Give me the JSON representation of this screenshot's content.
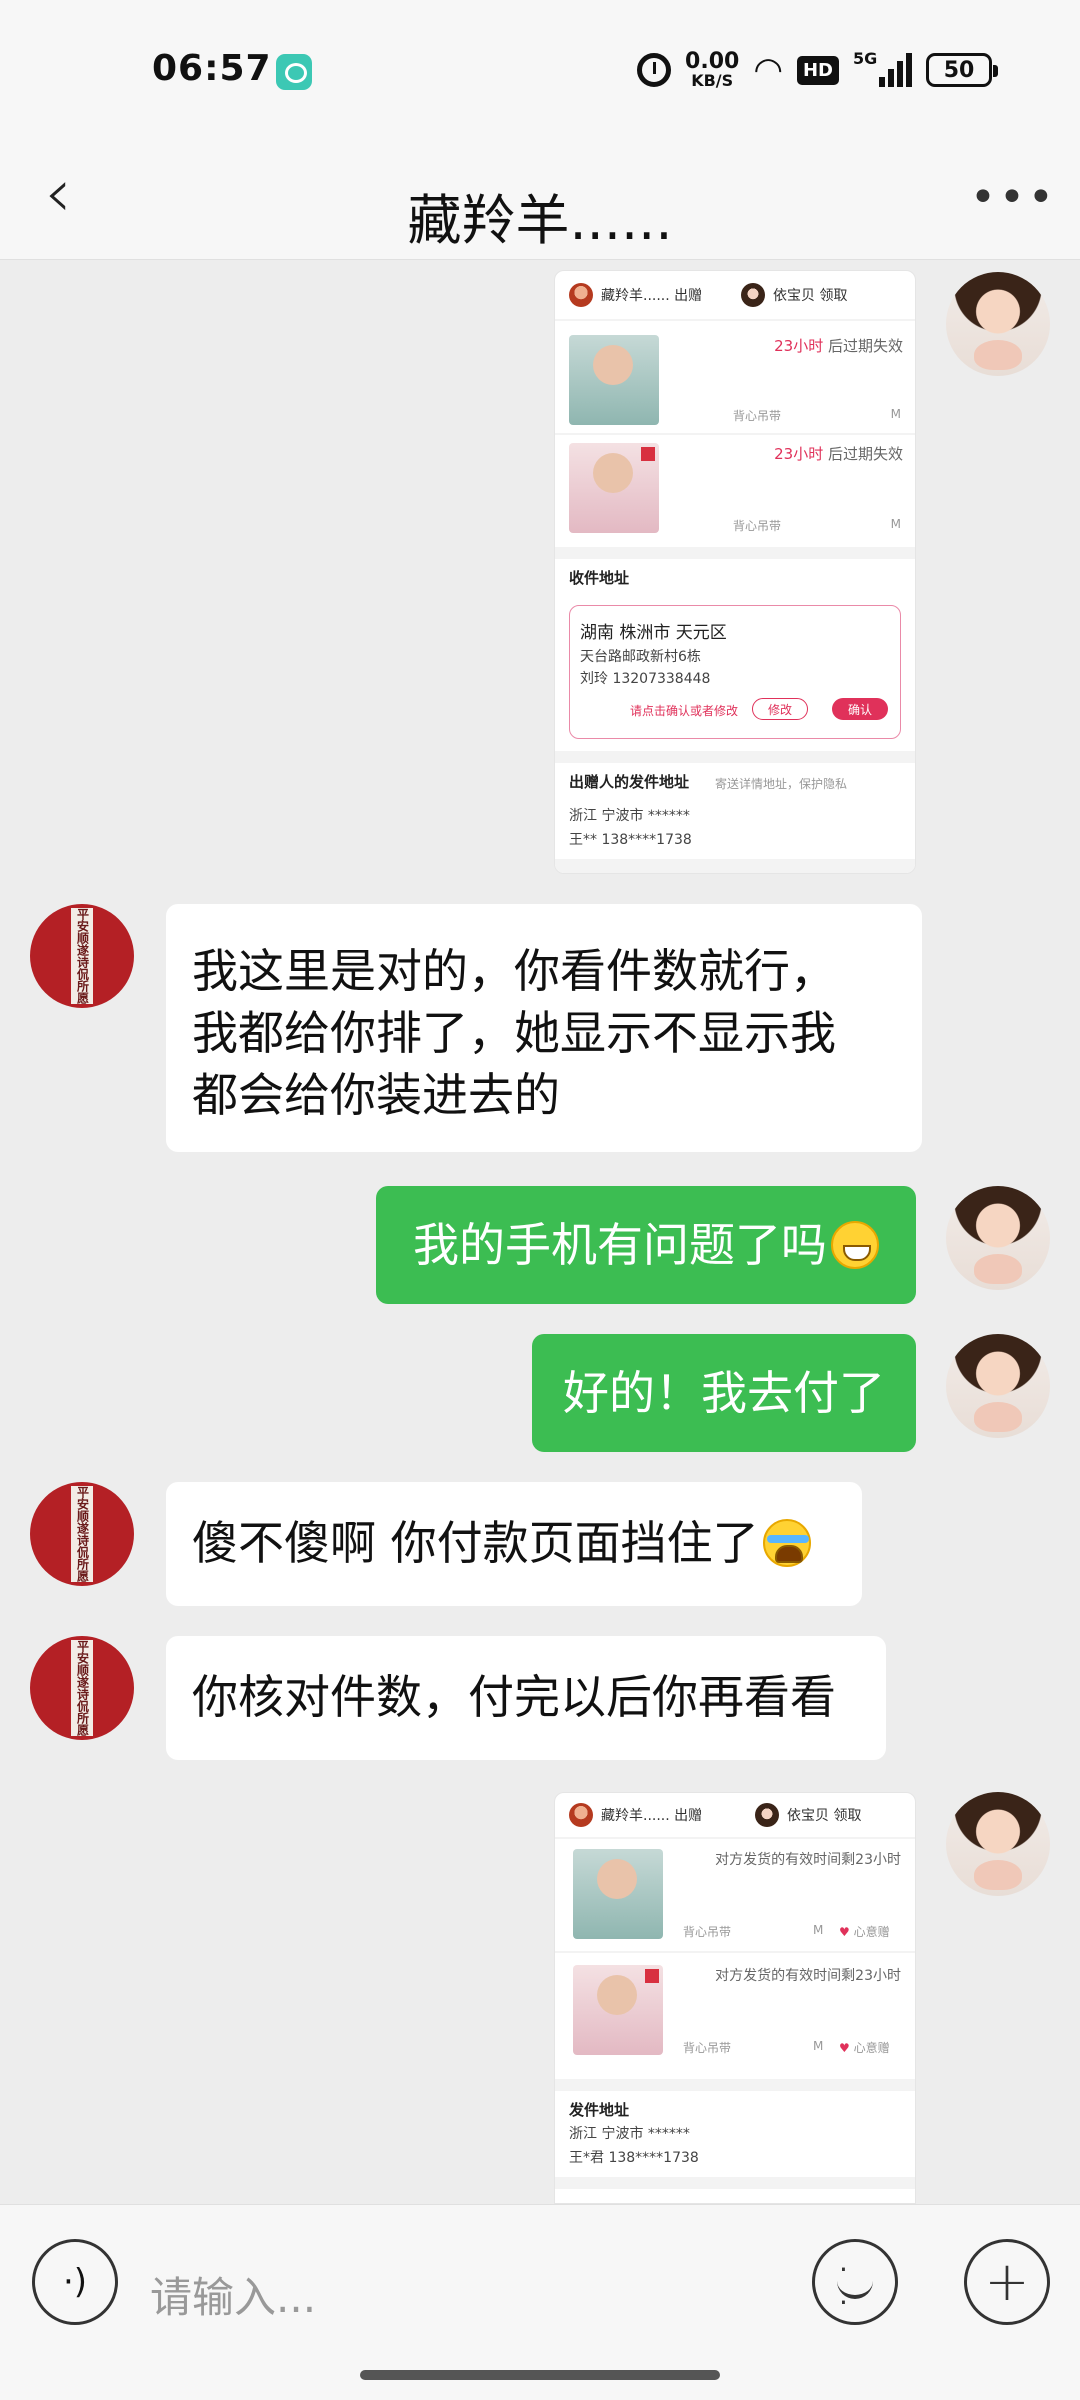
{
  "status_bar": {
    "time": "06:57",
    "net_speed_value": "0.00",
    "net_speed_unit": "KB/S",
    "hd": "HD",
    "signal": "5G",
    "battery": "50"
  },
  "header": {
    "title": "藏羚羊......"
  },
  "screenshot1": {
    "sender_name": "藏羚羊...... 出赠",
    "receiver_name": "依宝贝 领取",
    "items": [
      {
        "hours": "23小时",
        "suffix": "后过期失效",
        "name": "背心吊带",
        "size": "M"
      },
      {
        "hours": "23小时",
        "suffix": "后过期失效",
        "name": "背心吊带",
        "size": "M"
      }
    ],
    "address_title": "收件地址",
    "address_region": "湖南 株洲市 天元区",
    "address_detail": "天台路邮政新村6栋",
    "address_contact": "刘玲 13207338448",
    "address_hint": "请点击确认或者修改",
    "modify_label": "修改",
    "confirm_label": "确认",
    "sender_addr_title": "出赠人的发件地址",
    "sender_addr_hint": "寄送详情地址，保护隐私",
    "sender_addr_region": "浙江 宁波市 ******",
    "sender_addr_contact": "王** 138****1738"
  },
  "screenshot2": {
    "sender_name": "藏羚羊...... 出赠",
    "receiver_name": "依宝贝 领取",
    "items": [
      {
        "note": "对方发货的有效时间剩23小时",
        "name": "背心吊带",
        "size": "M",
        "tag": "心意赠"
      },
      {
        "note": "对方发货的有效时间剩23小时",
        "name": "背心吊带",
        "size": "M",
        "tag": "心意赠"
      }
    ],
    "ship_title": "发件地址",
    "ship_region": "浙江 宁波市 ******",
    "ship_contact": "王*君 138****1738"
  },
  "messages": {
    "m1_line1": "我这里是对的，你看件数就行，",
    "m1_line2": "我都给你排了，她显示不显示我",
    "m1_line3": "都会给你装进去的",
    "m2": "我的手机有问题了吗",
    "m3": "好的！我去付了",
    "m4": "傻不傻啊 你付款页面挡住了",
    "m5": "你核对件数，付完以后你再看看"
  },
  "seal_text": "平安顺遂诗侃所愿",
  "input": {
    "placeholder": "请输入..."
  },
  "colors": {
    "green_bubble": "#3cbd52",
    "accent_pink": "#e0315a"
  }
}
